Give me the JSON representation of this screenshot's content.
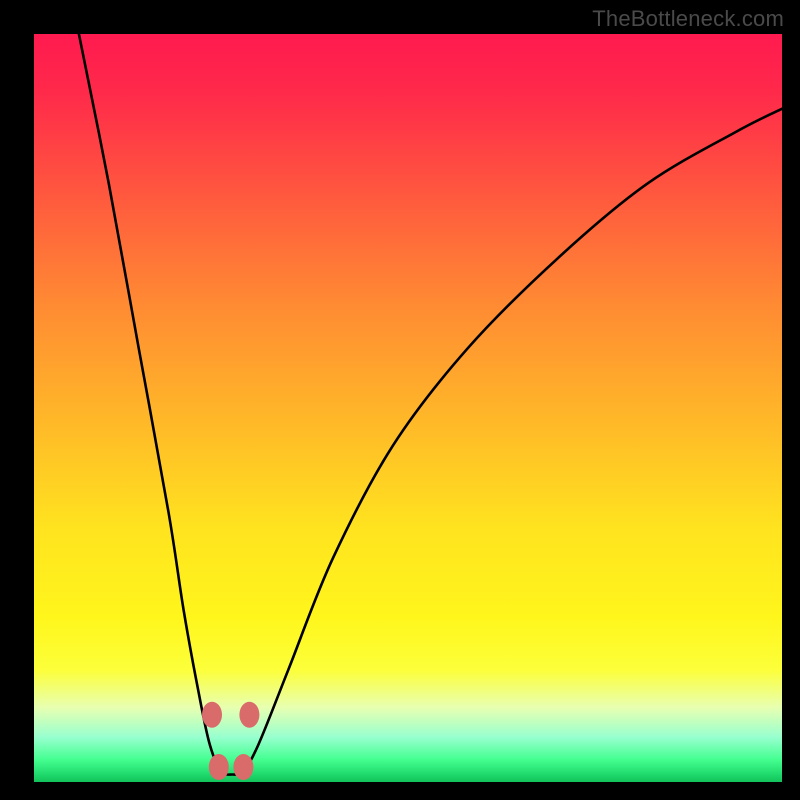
{
  "attribution": "TheBottleneck.com",
  "colors": {
    "page_bg": "#000000",
    "gradient_top": "#ff1a4f",
    "gradient_bottom": "#11c25a",
    "curve_stroke": "#000000",
    "marker_fill": "#d96b6b",
    "marker_stroke": "#b94f4f"
  },
  "chart_data": {
    "type": "line",
    "title": "",
    "xlabel": "",
    "ylabel": "",
    "xlim": [
      0,
      100
    ],
    "ylim": [
      0,
      100
    ],
    "note": "No numerical axes or tick labels are visible in the image; x and values below are estimated from the curve geometry on a 0–100 normalized scale (y = vertical position, 0 = bottom/green, 100 = top/red).",
    "series": [
      {
        "name": "curve",
        "x": [
          6,
          10,
          14,
          18,
          20,
          22,
          23.5,
          25,
          26.5,
          28,
          30,
          34,
          40,
          48,
          58,
          70,
          82,
          94,
          100
        ],
        "values": [
          100,
          80,
          58,
          36,
          23,
          12,
          5,
          1.5,
          1,
          1.5,
          5,
          15,
          30,
          45,
          58,
          70,
          80,
          87,
          90
        ]
      }
    ],
    "minimum": {
      "x": 26,
      "y": 1
    },
    "markers": [
      {
        "x": 23.8,
        "y": 9
      },
      {
        "x": 28.8,
        "y": 9
      },
      {
        "x": 24.7,
        "y": 2
      },
      {
        "x": 28.0,
        "y": 2
      }
    ]
  }
}
